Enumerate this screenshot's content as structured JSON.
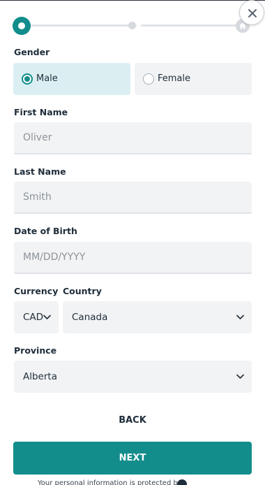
{
  "form": {
    "gender": {
      "label": "Gender",
      "options": [
        {
          "label": "Male",
          "selected": true
        },
        {
          "label": "Female",
          "selected": false
        }
      ]
    },
    "first_name": {
      "label": "First Name",
      "placeholder": "Oliver",
      "value": ""
    },
    "last_name": {
      "label": "Last Name",
      "placeholder": "Smith",
      "value": ""
    },
    "dob": {
      "label": "Date of Birth",
      "placeholder": "MM/DD/YYYY",
      "value": ""
    },
    "currency": {
      "label": "Currency",
      "selected": "CAD"
    },
    "country": {
      "label": "Country",
      "selected": "Canada"
    },
    "province": {
      "label": "Province",
      "selected": "Alberta"
    }
  },
  "actions": {
    "back_label": "BACK",
    "next_label": "NEXT"
  },
  "footer": {
    "note": "Your personal information is protected by"
  },
  "progress": {
    "current_step": 1,
    "total_steps": 3,
    "final_step_icon": "home-icon"
  },
  "colors": {
    "accent": "#128d8c",
    "selected_bg": "#dbeff3",
    "field_bg": "#f2f3f4"
  },
  "icons": {
    "close": "close-icon",
    "dropdown": "chevron-down-icon"
  }
}
